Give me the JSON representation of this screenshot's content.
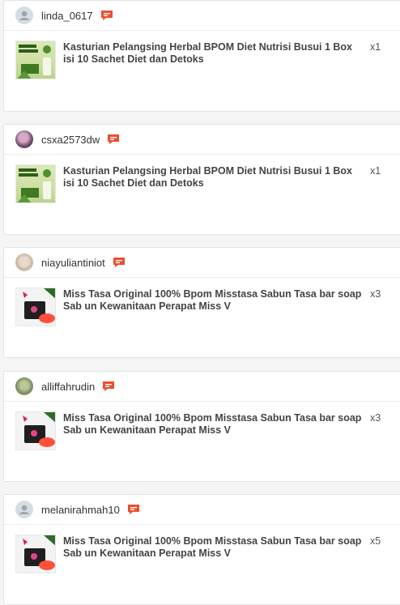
{
  "orders": [
    {
      "username": "linda_0617",
      "avatar": "default-user-icon",
      "product": "Kasturian Pelangsing Herbal BPOM Diet Nutrisi Busui 1 Box isi 10 Sachet Diet dan Detoks",
      "quantity": "x1",
      "product_image": "kasturian"
    },
    {
      "username": "csxa2573dw",
      "avatar": "photo",
      "product": "Kasturian Pelangsing Herbal BPOM Diet Nutrisi Busui 1 Box isi 10 Sachet Diet dan Detoks",
      "quantity": "x1",
      "product_image": "kasturian"
    },
    {
      "username": "niayuliantiniot",
      "avatar": "photo",
      "product": "Miss Tasa Original 100% Bpom Misstasa Sabun Tasa bar soap Sab un Kewanitaan Perapat Miss V",
      "quantity": "x3",
      "product_image": "misstasa"
    },
    {
      "username": "alliffahrudin",
      "avatar": "photo",
      "product": "Miss Tasa Original 100% Bpom Misstasa Sabun Tasa bar soap Sab un Kewanitaan Perapat Miss V",
      "quantity": "x3",
      "product_image": "misstasa"
    },
    {
      "username": "melanirahmah10",
      "avatar": "default-user-icon",
      "product": "Miss Tasa Original 100% Bpom Misstasa Sabun Tasa bar soap Sab un Kewanitaan Perapat Miss V",
      "quantity": "x5",
      "product_image": "misstasa"
    }
  ],
  "colors": {
    "chat_accent": "#ee4d2d"
  }
}
